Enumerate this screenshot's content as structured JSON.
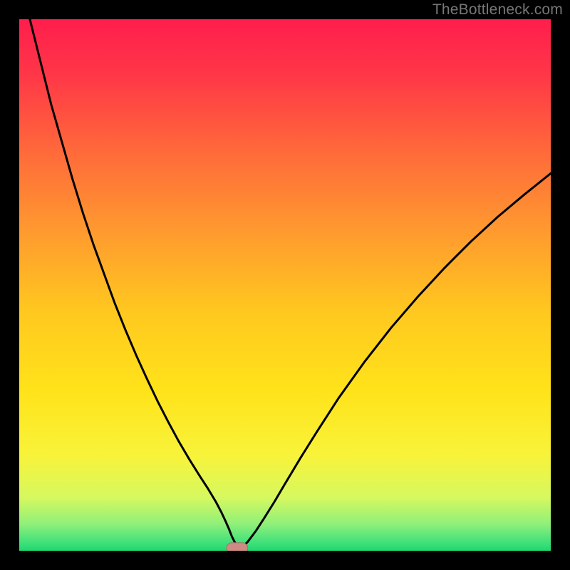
{
  "attribution": "TheBottleneck.com",
  "colors": {
    "frame": "#000000",
    "gradient_stops": [
      {
        "offset": 0.0,
        "color": "#ff1e4c"
      },
      {
        "offset": 0.1,
        "color": "#ff3548"
      },
      {
        "offset": 0.25,
        "color": "#ff6a3a"
      },
      {
        "offset": 0.4,
        "color": "#ff9a2f"
      },
      {
        "offset": 0.55,
        "color": "#ffc81f"
      },
      {
        "offset": 0.7,
        "color": "#ffe31a"
      },
      {
        "offset": 0.82,
        "color": "#f8f33a"
      },
      {
        "offset": 0.9,
        "color": "#d6f85f"
      },
      {
        "offset": 0.95,
        "color": "#8ff07a"
      },
      {
        "offset": 0.985,
        "color": "#3fe07a"
      },
      {
        "offset": 1.0,
        "color": "#1fd86f"
      }
    ],
    "curve": "#000000",
    "marker_fill": "#cd8b83",
    "marker_stroke": "#a96f68"
  },
  "chart_data": {
    "type": "line",
    "title": "",
    "xlabel": "",
    "ylabel": "",
    "xlim": [
      0,
      100
    ],
    "ylim": [
      0,
      100
    ],
    "x": [
      0,
      2,
      4,
      6,
      8,
      10,
      12,
      14,
      16,
      18,
      20,
      22,
      24,
      26,
      28,
      30,
      32,
      34,
      35.5,
      37,
      38,
      38.8,
      39.5,
      40,
      40.5,
      41,
      41.5,
      42,
      43,
      44.5,
      46,
      48,
      50,
      53,
      56,
      60,
      65,
      70,
      75,
      80,
      85,
      90,
      95,
      100
    ],
    "values": [
      110,
      100,
      92,
      84,
      77,
      70,
      63.5,
      57.5,
      52,
      46.5,
      41.5,
      36.8,
      32.4,
      28.2,
      24.3,
      20.6,
      17.2,
      14,
      11.7,
      9.2,
      7.3,
      5.6,
      4.0,
      2.7,
      1.7,
      0.9,
      0.5,
      0.7,
      1.7,
      3.7,
      6.0,
      9.2,
      12.6,
      17.6,
      22.4,
      28.6,
      35.6,
      42.0,
      47.8,
      53.2,
      58.2,
      62.8,
      67.0,
      71.0
    ],
    "marker": {
      "x": 41.0,
      "y": 0.5,
      "rx": 2.0,
      "ry": 1.0
    },
    "legend": []
  }
}
